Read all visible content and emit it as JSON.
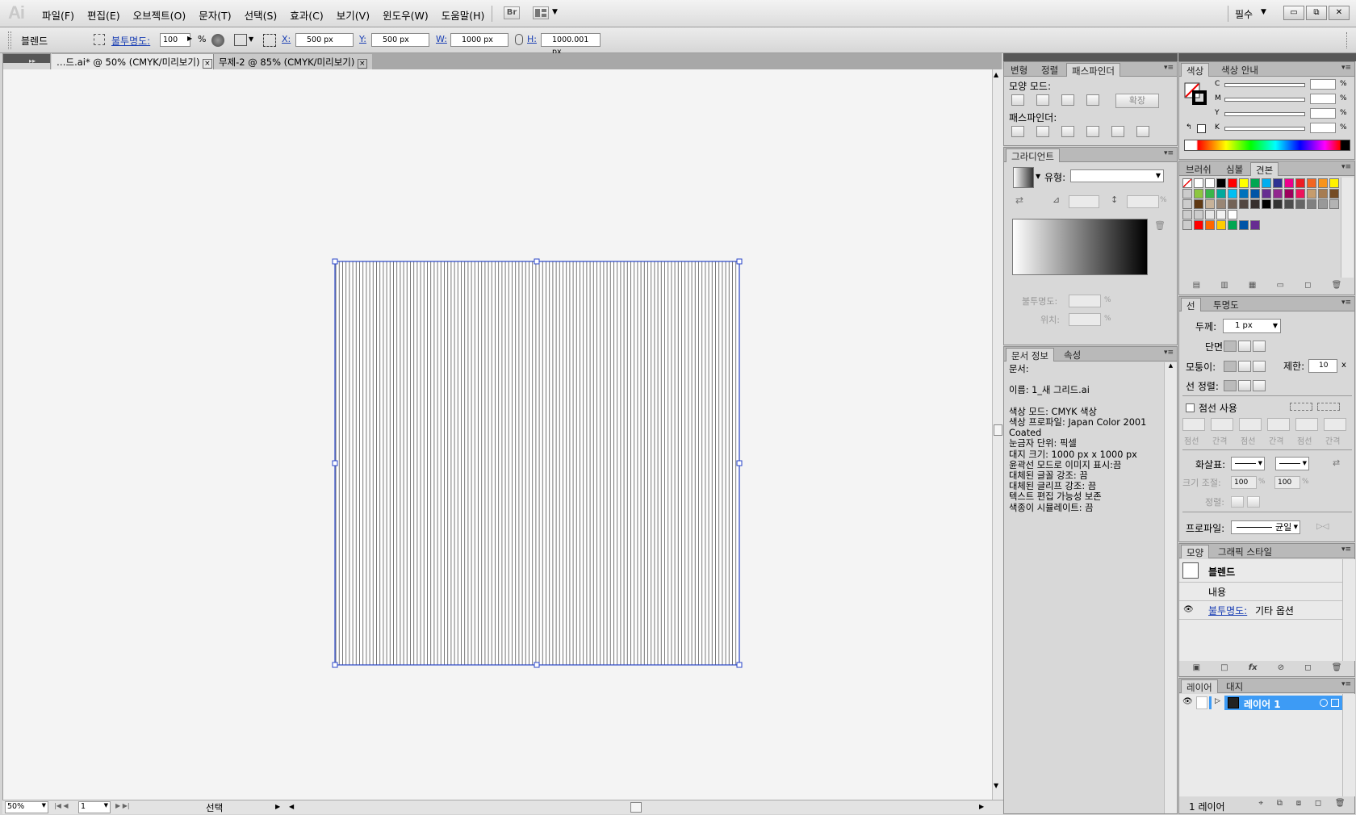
{
  "app": {
    "logo": "Ai"
  },
  "menu": [
    "파일(F)",
    "편집(E)",
    "오브젝트(O)",
    "문자(T)",
    "선택(S)",
    "효과(C)",
    "보기(V)",
    "윈도우(W)",
    "도움말(H)"
  ],
  "bridge_label": "Br",
  "workspace": {
    "label": "필수"
  },
  "window_buttons": {
    "minimize": "▭",
    "restore": "⧉",
    "close": "✕"
  },
  "control": {
    "object_type": "블렌드",
    "opacity_label": "불투명도:",
    "opacity_value": "100",
    "opacity_unit": "%",
    "x_label": "X:",
    "x_value": "500 px",
    "y_label": "Y:",
    "y_value": "500 px",
    "w_label": "W:",
    "w_value": "1000 px",
    "h_label": "H:",
    "h_value": "1000.001 px"
  },
  "tabs": [
    {
      "label": "…드.ai* @ 50% (CMYK/미리보기)",
      "close": "×"
    },
    {
      "label": "무제-2 @ 85% (CMYK/미리보기)",
      "close": "×"
    }
  ],
  "status": {
    "zoom": "50%",
    "page": "1",
    "tool": "선택"
  },
  "pathfinder": {
    "tabs": [
      "변형",
      "정렬",
      "패스파인더"
    ],
    "shape_modes_label": "모양 모드:",
    "expand_label": "확장",
    "pathfinders_label": "패스파인더:"
  },
  "gradient": {
    "tab": "그라디언트",
    "type_label": "유형:",
    "opacity_label": "불투명도:",
    "location_label": "위치:",
    "percent": "%"
  },
  "docinfo": {
    "tabs": [
      "문서 정보",
      "속성"
    ],
    "lines": [
      "문서:",
      "",
      "이름: 1_새 그리드.ai",
      "",
      "색상 모드: CMYK 색상",
      "색상 프로파일: Japan Color 2001",
      "Coated",
      "눈금자 단위: 픽셀",
      "대지 크기: 1000 px x 1000 px",
      "윤곽선 모드로 이미지 표시:끔",
      "대체된 글꼴 강조: 끔",
      "대체된 글리프 강조: 끔",
      "텍스트 편집 가능성 보존",
      "색종이 시뮬레이트: 끔"
    ]
  },
  "color": {
    "tabs": [
      "색상",
      "색상 안내"
    ],
    "channels": [
      "C",
      "M",
      "Y",
      "K"
    ],
    "percent": "%"
  },
  "swatches": {
    "tabs": [
      "브러쉬",
      "심볼",
      "견본"
    ],
    "rows": [
      [
        "#ffffff",
        "#ffffff",
        "#000000",
        "#ff0000",
        "#ffff00",
        "#00a651",
        "#00aeef",
        "#2e3192",
        "#ec008c",
        "#ed1c24",
        "#f26522",
        "#f7941d",
        "#fff200"
      ],
      [
        "#8dc63f",
        "#39b54a",
        "#00a99d",
        "#00bff3",
        "#0072bc",
        "#0054a6",
        "#662d91",
        "#92278f",
        "#9e005d",
        "#ed145b",
        "#c69c6d",
        "#a67c52",
        "#754c24"
      ],
      [
        "#603913",
        "#c7b299",
        "#998675",
        "#736357",
        "#534741",
        "#362f2d",
        "#000000",
        "#333333",
        "#4d4d4d",
        "#666666",
        "#808080",
        "#999999",
        "#b3b3b3"
      ],
      [
        "#cccccc",
        "#e6e6e6",
        "#f2f2f2",
        "#ffffff"
      ],
      [
        "#ff0000",
        "#ff6600",
        "#ffcc00",
        "#00a651",
        "#0054a6",
        "#662d91"
      ]
    ]
  },
  "stroke": {
    "tabs": [
      "선",
      "투명도"
    ],
    "weight_label": "두께:",
    "weight_value": "1 px",
    "cap_label": "단면:",
    "corner_label": "모퉁이:",
    "limit_label": "제한:",
    "limit_value": "10",
    "limit_unit": "x",
    "align_label": "선 정렬:",
    "dashed_label": "점선 사용",
    "dash_labels": [
      "점선",
      "간격",
      "점선",
      "간격",
      "점선",
      "간격"
    ],
    "arrow_label": "화살표:",
    "scale_label": "크기 조절:",
    "scale_a": "100",
    "scale_b": "100",
    "percent": "%",
    "align2_label": "정렬:",
    "profile_label": "프로파일:",
    "profile_value": "균일"
  },
  "appearance": {
    "tabs": [
      "모양",
      "그래픽 스타일"
    ],
    "title": "블렌드",
    "contents": "내용",
    "opacity_link": "불투명도:",
    "opacity_value": "기타 옵션"
  },
  "layers": {
    "tabs": [
      "레이어",
      "대지"
    ],
    "layer_name": "레이어 1",
    "count": "1 레이어",
    "selected_color": "#3d9bf5"
  }
}
